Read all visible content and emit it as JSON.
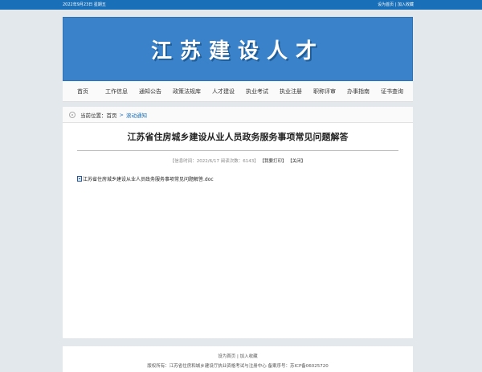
{
  "topbar": {
    "date": "2022年9月23日 星期五",
    "set_home": "设为首页",
    "sep": " | ",
    "favorite": "加入收藏"
  },
  "banner": {
    "title": "江苏建设人才"
  },
  "nav": {
    "items": [
      "首页",
      "工作信息",
      "通知公告",
      "政策法规库",
      "人才建设",
      "执业考试",
      "执业注册",
      "职称评审",
      "办事指南",
      "证书查询"
    ]
  },
  "breadcrumb": {
    "label": "当前位置：",
    "home": "首页",
    "sep": ">",
    "current": "滚动通知"
  },
  "article": {
    "title": "江苏省住房城乡建设从业人员政务服务事项常见问题解答",
    "meta_info": "【信息时间：2022/6/17    阅读次数：6143】",
    "print": "【我要打印】",
    "close": "【关闭】",
    "attachment": "江苏省住房城乡建设从业人员政务服务事项常见问题解答.doc"
  },
  "footer": {
    "set_home": "设为首页",
    "sep": " | ",
    "favorite": "加入收藏",
    "copyright": "版权所有：江苏省住房和城乡建设厅执业资格考试与注册中心   备案序号：苏ICP备06025720"
  },
  "colors": {
    "topbar": "#1a70b8",
    "banner": "#3a82c9",
    "background": "#e3e8ec"
  }
}
